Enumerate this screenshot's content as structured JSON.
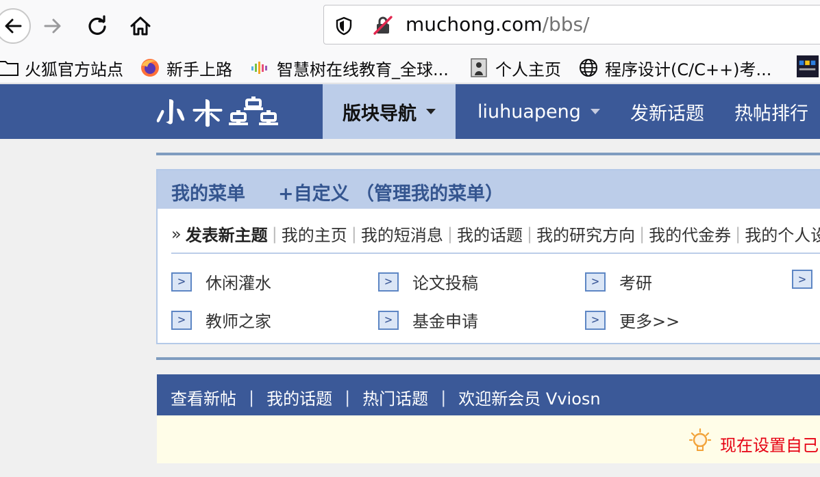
{
  "browser": {
    "url_host": "muchong.com",
    "url_path": "/bbs/",
    "bookmarks": [
      {
        "label": "火狐官方站点",
        "icon": "folder-icon"
      },
      {
        "label": "新手上路",
        "icon": "firefox-icon"
      },
      {
        "label": "智慧树在线教育_全球...",
        "icon": "zhihuishu-icon"
      },
      {
        "label": "个人主页",
        "icon": "person-page-icon"
      },
      {
        "label": "程序设计(C/C++)考...",
        "icon": "globe-icon"
      }
    ]
  },
  "header": {
    "nav_active": "版块导航",
    "user": "liuhuapeng",
    "new_topic": "发新话题",
    "hot": "热帖排行"
  },
  "menu": {
    "title": "我的菜单",
    "custom": "+自定义 （管理我的菜单）",
    "prefix": "»",
    "links": [
      "发表新主题",
      "我的主页",
      "我的短消息",
      "我的话题",
      "我的研究方向",
      "我的代金券",
      "我的个人设"
    ],
    "box_label": ">",
    "quick": [
      "休闲灌水",
      "论文投稿",
      "考研",
      "教师之家",
      "基金申请",
      "更多>>"
    ]
  },
  "bar": {
    "items": [
      "查看新帖",
      "我的话题",
      "热门话题"
    ],
    "sep": "|",
    "welcome": "欢迎新会员 Vviosn"
  },
  "notice": {
    "text": "现在设置自己"
  },
  "colors": {
    "brand": "#3b5998",
    "active_tab": "#bccde9",
    "notice_red": "#e60012"
  }
}
